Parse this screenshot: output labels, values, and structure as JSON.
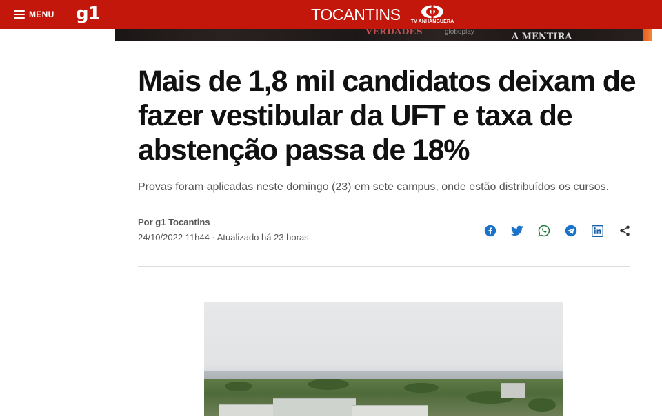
{
  "header": {
    "menu_label": "MENU",
    "menu_icon": "hamburger-icon",
    "logo": "g1",
    "region": "TOCANTINS",
    "affiliate": "TV ANHANGUERA",
    "brand_color": "#c4170c"
  },
  "banner": {
    "text_1": "VERDADES",
    "text_2": "globoplay",
    "text_3": "A MENTIRA"
  },
  "article": {
    "headline": "Mais de 1,8 mil candidatos deixam de fazer vestibular da UFT e taxa de abstenção passa de 18%",
    "subheadline": "Provas foram aplicadas neste domingo (23) em sete campus, onde estão distribuídos os cursos.",
    "byline": "Por g1 Tocantins",
    "dateline": "24/10/2022 11h44 · Atualizado há 23 horas"
  },
  "share": {
    "items": [
      {
        "name": "facebook-icon"
      },
      {
        "name": "twitter-icon"
      },
      {
        "name": "whatsapp-icon"
      },
      {
        "name": "telegram-icon"
      },
      {
        "name": "linkedin-icon"
      },
      {
        "name": "share-icon"
      }
    ],
    "icon_color": "#1a73c8"
  }
}
